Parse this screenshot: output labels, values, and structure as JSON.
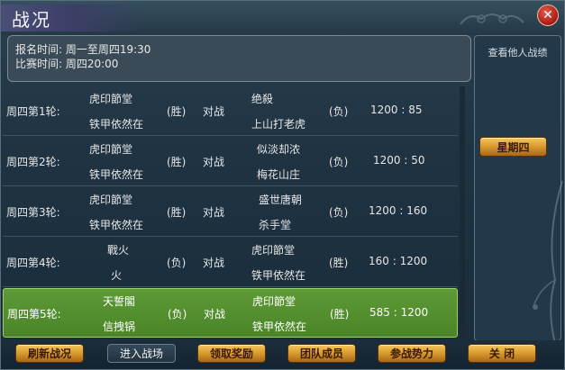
{
  "window": {
    "title": "战况",
    "close_label": "✕"
  },
  "schedule": {
    "signup_time": "报名时间: 周一至周四19:30",
    "match_time": "比赛时间: 周四20:00"
  },
  "side": {
    "view_others": "查看他人战绩",
    "day_button": "星期四"
  },
  "rounds": [
    {
      "round": "周四第1轮:",
      "left_team": "虎印節堂",
      "left_leader": "铁甲依然在",
      "left_result": "(胜)",
      "vs": "对战",
      "right_team": "绝殺",
      "right_leader": "上山打老虎",
      "right_result": "(负)",
      "score": "1200 : 85"
    },
    {
      "round": "周四第2轮:",
      "left_team": "虎印節堂",
      "left_leader": "铁甲依然在",
      "left_result": "(胜)",
      "vs": "对战",
      "right_team": "似淡却浓",
      "right_leader": "梅花山庄",
      "right_result": "(负)",
      "score": "1200 : 50"
    },
    {
      "round": "周四第3轮:",
      "left_team": "虎印節堂",
      "left_leader": "铁甲依然在",
      "left_result": "(胜)",
      "vs": "对战",
      "right_team": "盛世唐朝",
      "right_leader": "杀手堂",
      "right_result": "(负)",
      "score": "1200 : 160"
    },
    {
      "round": "周四第4轮:",
      "left_team": "戰火",
      "left_leader": "火",
      "left_result": "(负)",
      "vs": "对战",
      "right_team": "虎印節堂",
      "right_leader": "铁甲依然在",
      "right_result": "(胜)",
      "score": "160 : 1200"
    },
    {
      "round": "周四第5轮:",
      "left_team": "天誓閣",
      "left_leader": "信拽锅",
      "left_result": "(负)",
      "vs": "对战",
      "right_team": "虎印節堂",
      "right_leader": "铁甲依然在",
      "right_result": "(胜)",
      "score": "585 : 1200"
    }
  ],
  "buttons": {
    "refresh": "刷新战况",
    "enter": "进入战场",
    "claim": "领取奖励",
    "members": "团队成员",
    "factions": "参战势力",
    "close": "关  闭"
  },
  "colors": {
    "highlight_row": "#5e9a36",
    "gold_button": "#d89a2c",
    "close_button": "#a81a14"
  }
}
